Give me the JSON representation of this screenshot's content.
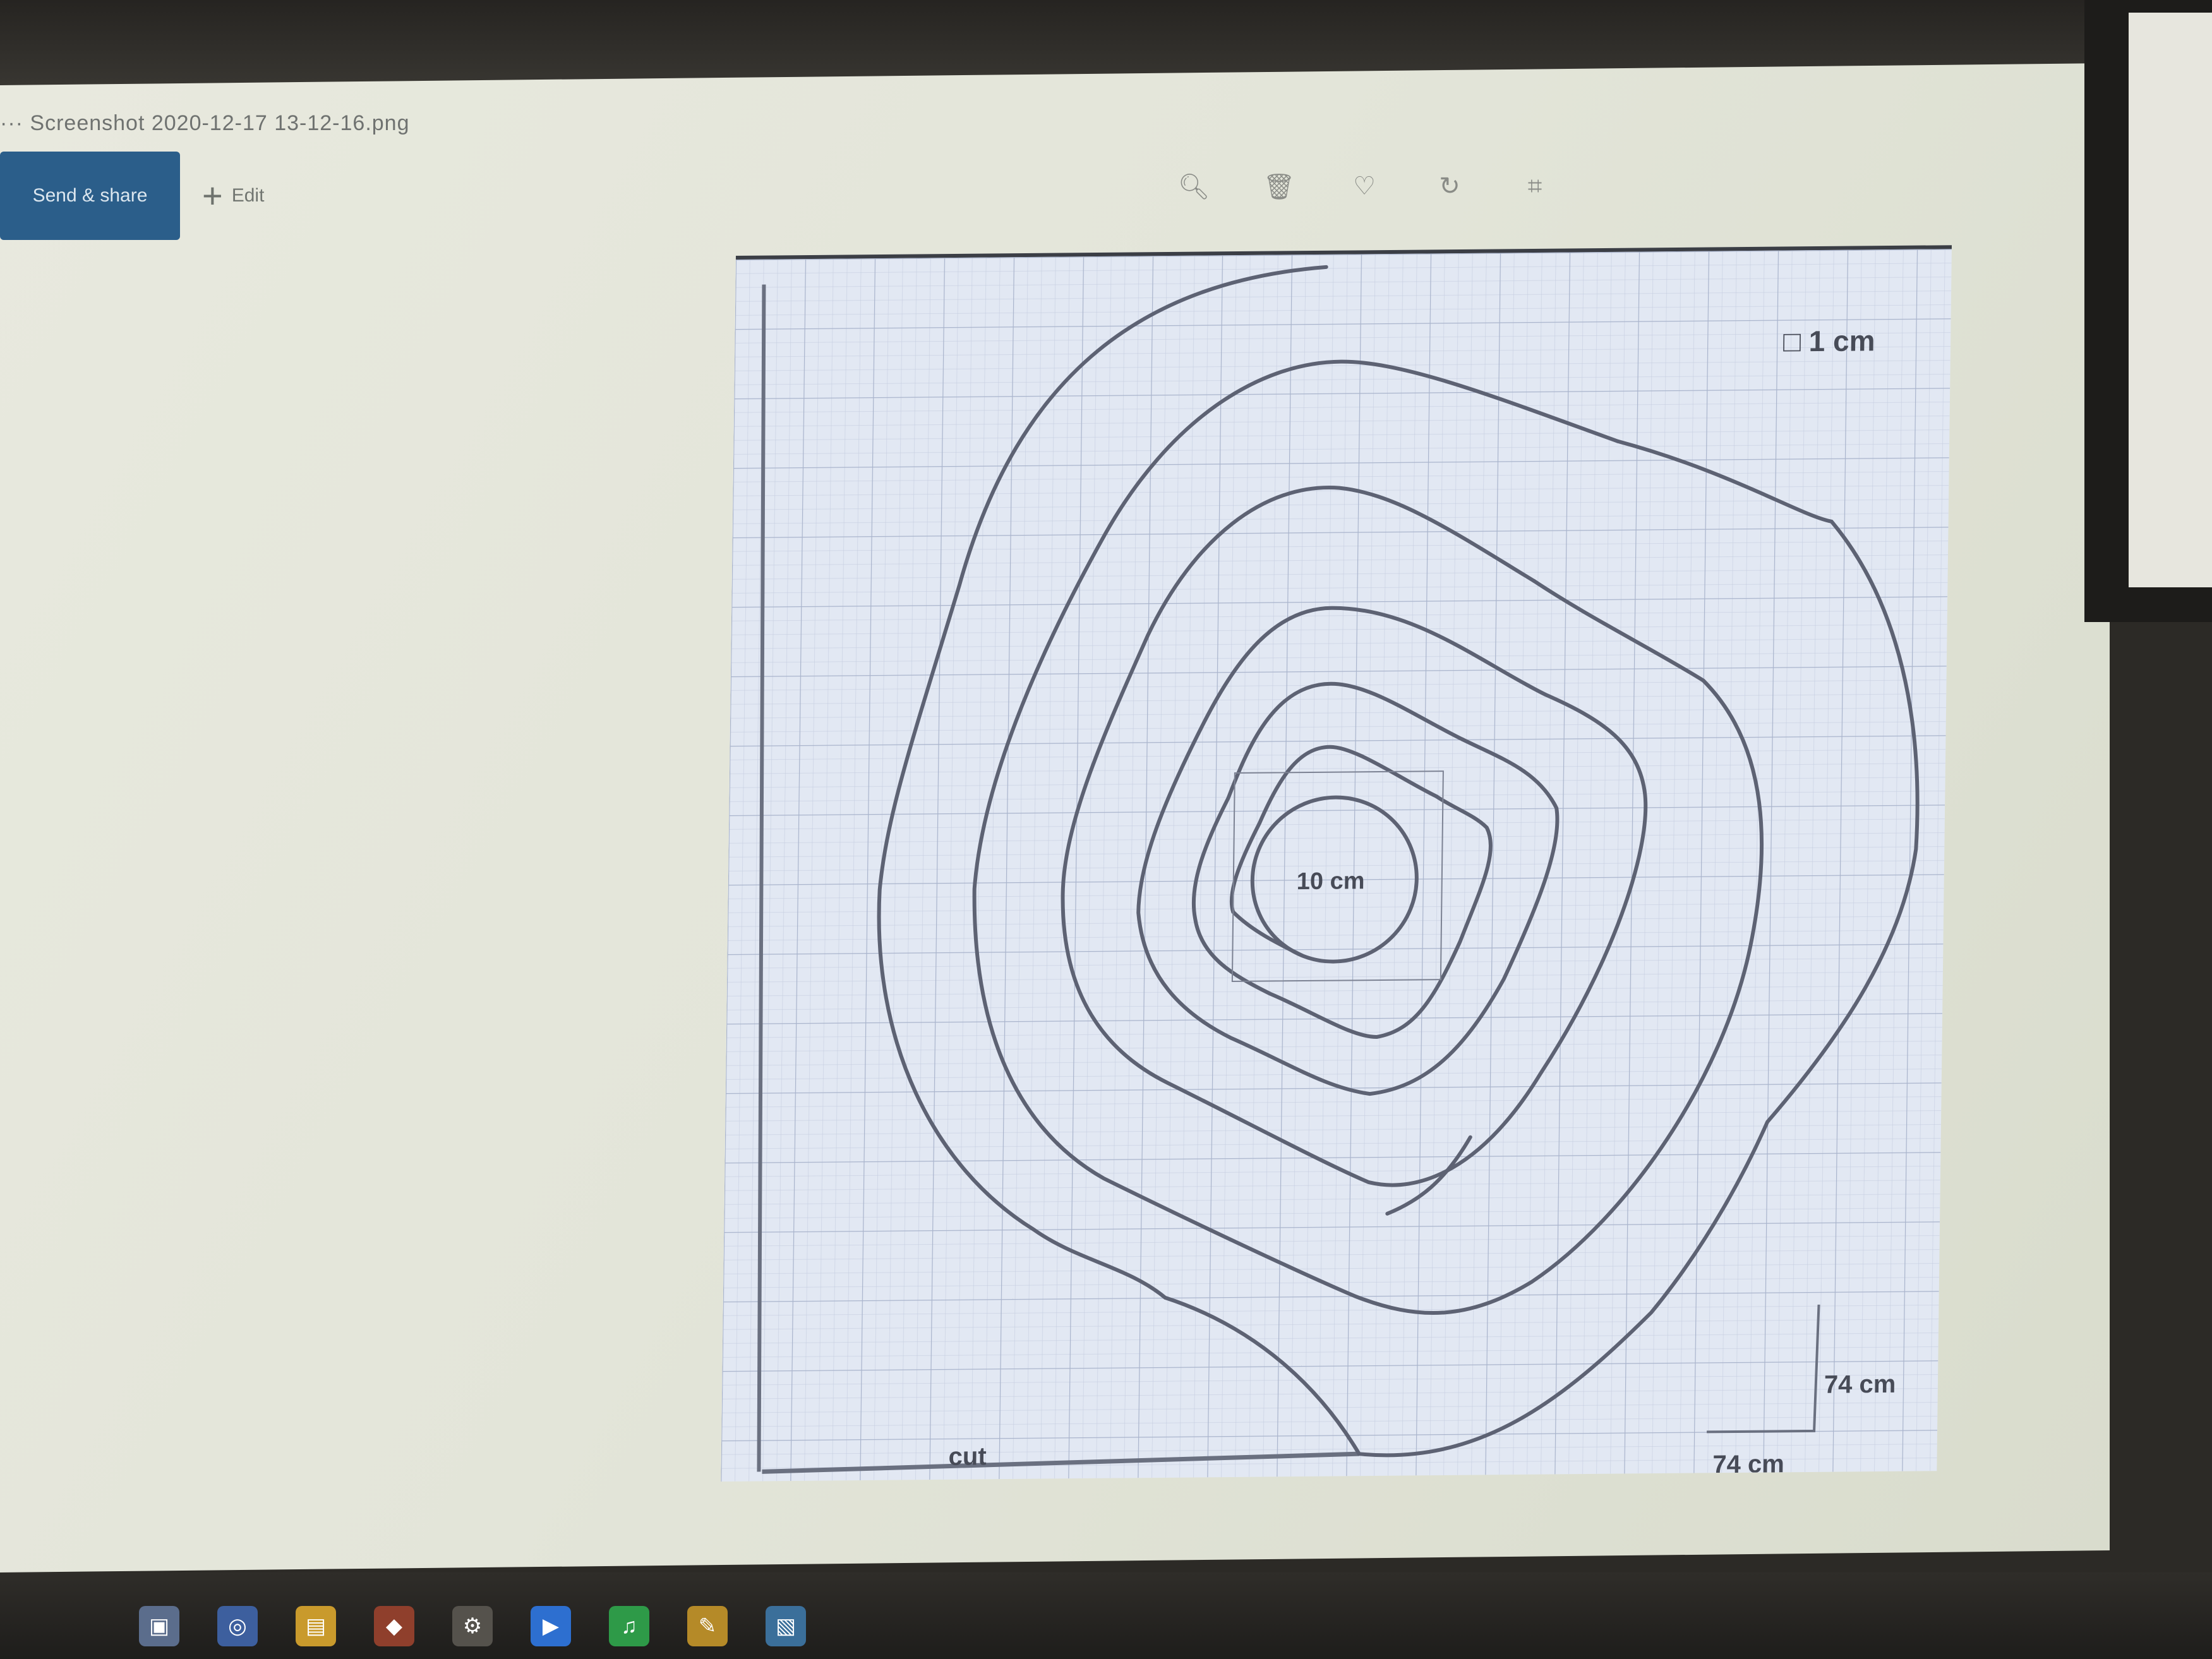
{
  "window": {
    "title_text": "···  Screenshot 2020-12-17 13-12-16.png"
  },
  "toolbar": {
    "primary_label": "Send & share",
    "secondary_label": "Edit",
    "tools": [
      "search-icon",
      "trash-icon",
      "heart-icon",
      "rotate-icon",
      "crop-icon"
    ]
  },
  "pattern": {
    "scale_label": "□ 1 cm",
    "center_label": "10 cm",
    "vertical_dim": "74 cm",
    "horizontal_dim": "74 cm",
    "cut_label": "cut"
  },
  "taskbar": {
    "icons": [
      "start-icon",
      "chrome-icon",
      "files-icon",
      "app-icon",
      "settings-icon",
      "zoom-icon",
      "spotify-icon",
      "paint-icon",
      "photos-icon"
    ]
  },
  "colors": {
    "accent_button": "#2b5e8a",
    "paper": "#e2e8f3",
    "grid_line": "#b9c3d9",
    "spiral_line": "#5d6273"
  }
}
